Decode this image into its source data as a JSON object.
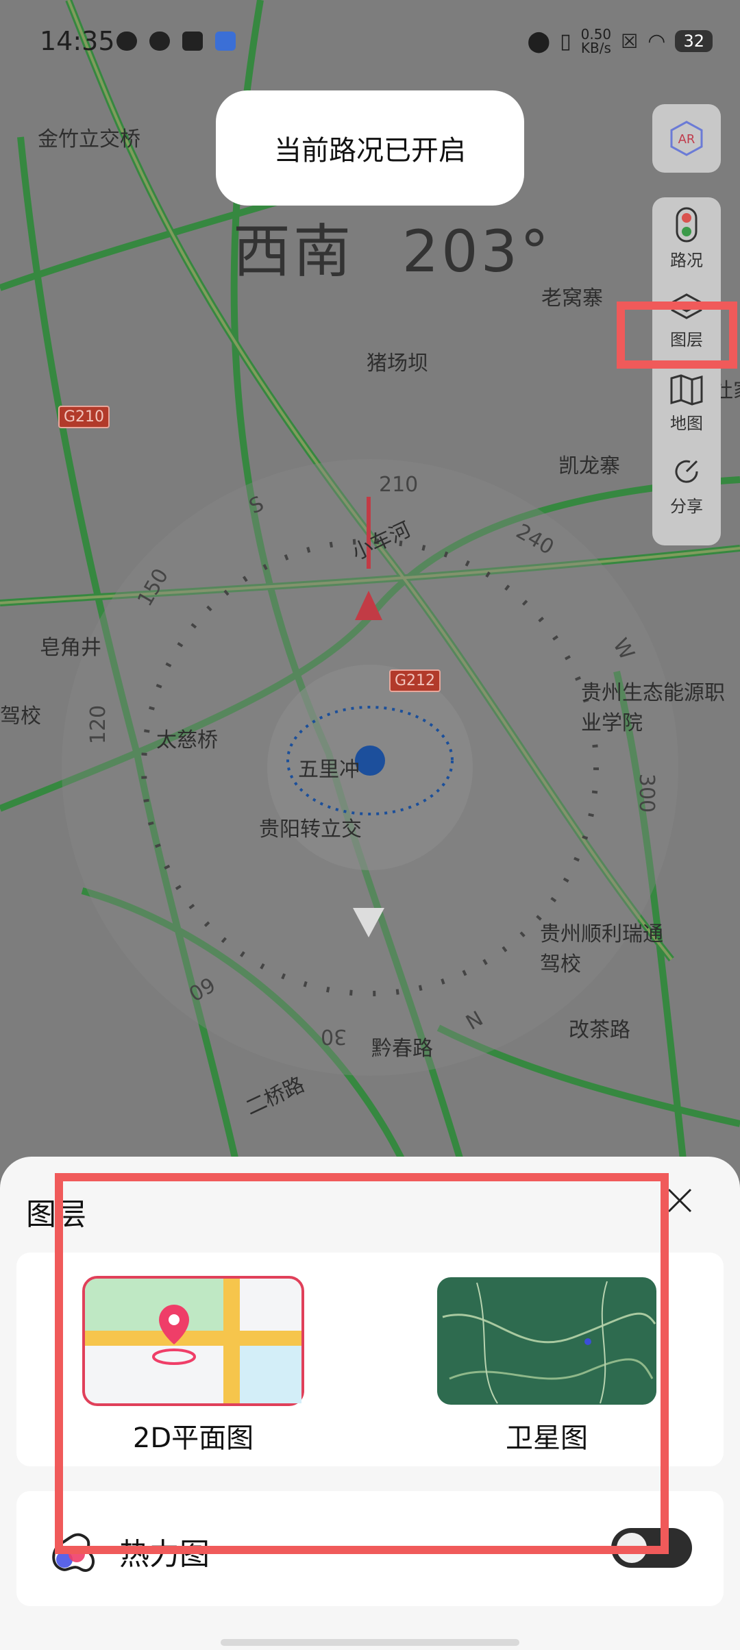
{
  "status_bar": {
    "time": "14:35",
    "net_speed_value": "0.50",
    "net_speed_unit": "KB/s",
    "battery": "32"
  },
  "toast": {
    "text": "当前路况已开启"
  },
  "heading": {
    "direction": "西南",
    "degrees": "203°"
  },
  "toolbar": {
    "ar_label": "AR",
    "items": [
      {
        "label": "路况",
        "icon": "traffic-light-icon"
      },
      {
        "label": "图层",
        "icon": "layers-icon"
      },
      {
        "label": "地图",
        "icon": "map-icon"
      },
      {
        "label": "分享",
        "icon": "share-icon"
      }
    ]
  },
  "map": {
    "labels": [
      "金竹立交桥",
      "老窝寨",
      "猪场坝",
      "凯龙寨",
      "小车河",
      "皂角井",
      "太慈桥",
      "五里冲",
      "贵阳转立交",
      "贵州生态能源职业学院",
      "贵州顺利瑞通驾校",
      "改茶路",
      "黔春路",
      "二桥路",
      "驾校",
      "杜家"
    ],
    "road_badges": [
      "G210",
      "G212"
    ],
    "compass_ticks": [
      "210",
      "240",
      "W",
      "300",
      "150",
      "120",
      "S",
      "60",
      "30",
      "N"
    ]
  },
  "sheet": {
    "title": "图层",
    "close_icon": "close-icon",
    "tiles": [
      {
        "label": "2D平面图"
      },
      {
        "label": "卫星图"
      }
    ],
    "heatmap": {
      "label": "热力图",
      "toggle_on": true
    }
  },
  "colors": {
    "highlight": "#f05a5a",
    "road": "#2f8a3a",
    "toast_bg": "#ffffff"
  }
}
